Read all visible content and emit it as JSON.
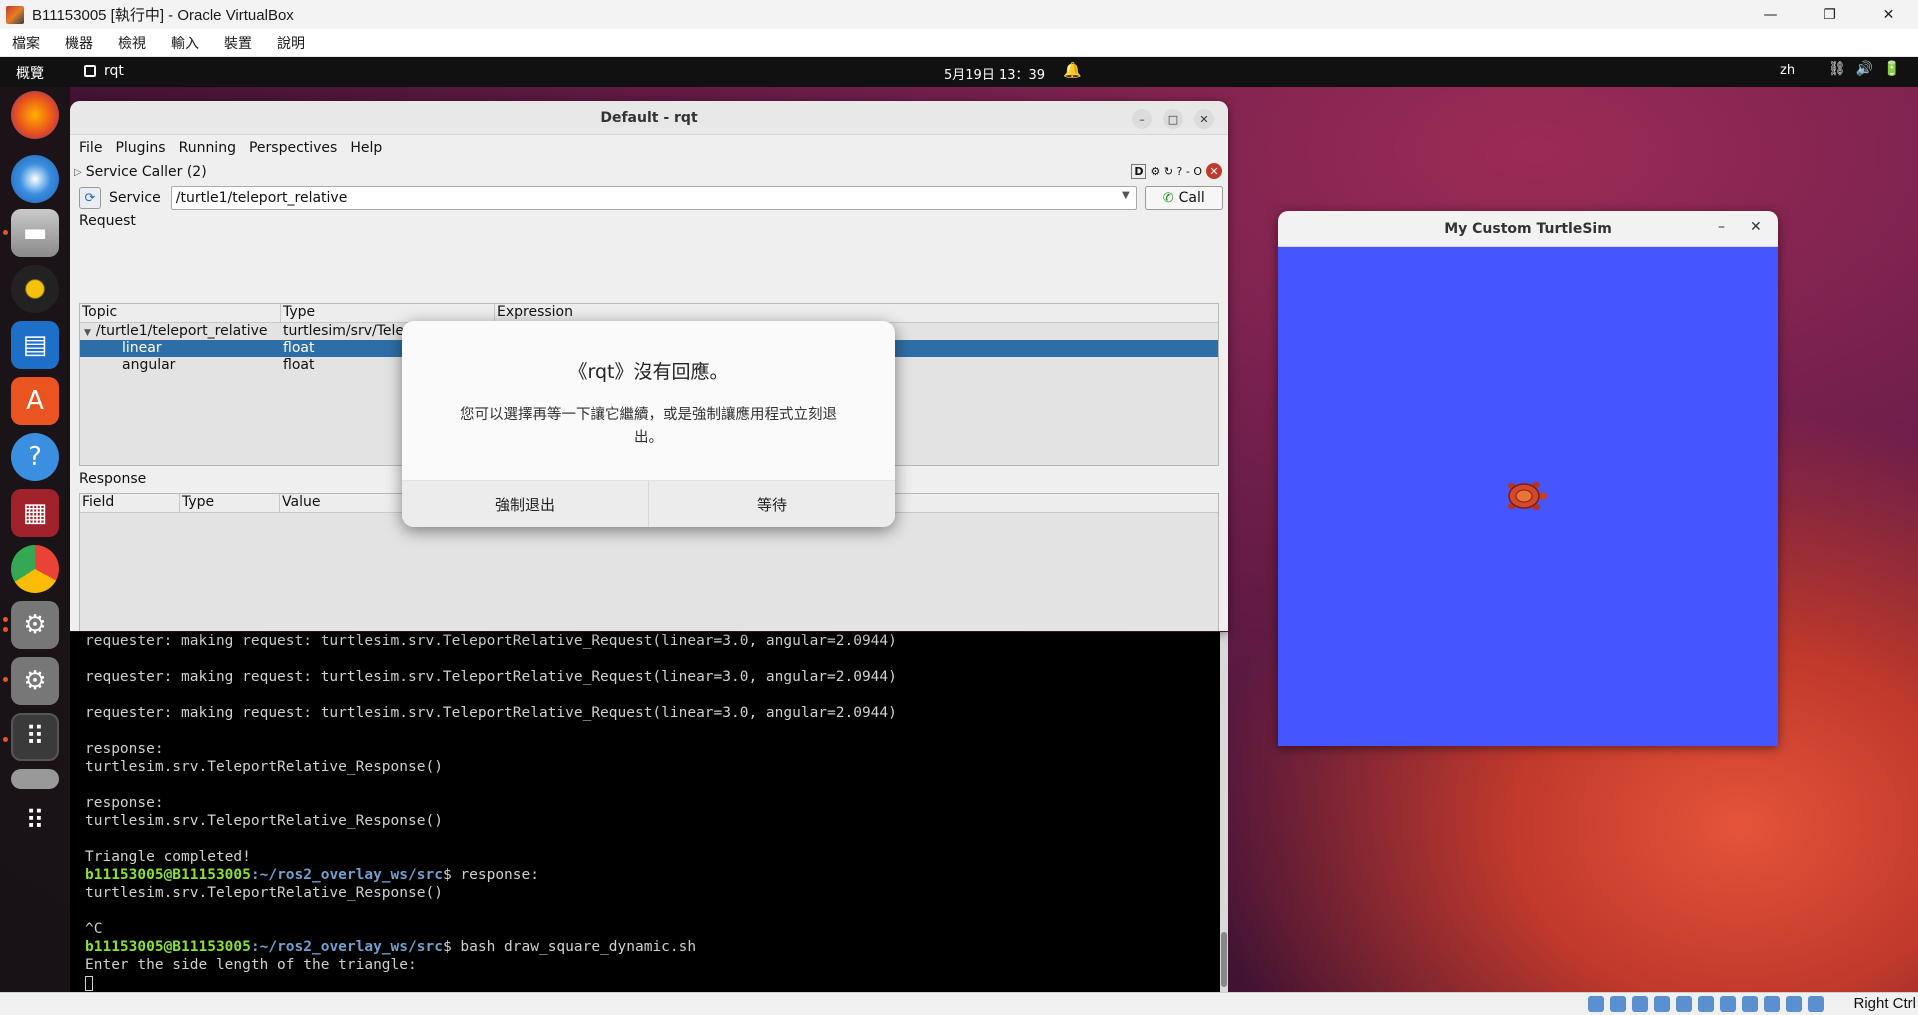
{
  "host": {
    "title": "B11153005 [執行中] - Oracle VirtualBox",
    "window_buttons": [
      "—",
      "❐",
      "✕"
    ],
    "menu": [
      "檔案",
      "機器",
      "檢視",
      "輸入",
      "裝置",
      "說明"
    ],
    "status_right": "Right Ctrl"
  },
  "topbar": {
    "activities": "概覽",
    "app_name": "rqt",
    "clock": "5月19日 13：39",
    "lang": "zh",
    "sys_icons": "⛓🔊🔋"
  },
  "dock": {
    "items": [
      "firefox-icon",
      "thunderbird-icon",
      "files-icon",
      "rhythmbox-icon",
      "writer-icon",
      "app-center-icon",
      "help-icon",
      "terminal-app-icon",
      "chrome-icon",
      "settings-icon",
      "settings-icon-2",
      "rqt-app-icon",
      "drive-icon",
      "show-apps-icon"
    ]
  },
  "rqt": {
    "title": "Default - rqt",
    "menu": [
      "File",
      "Plugins",
      "Running",
      "Perspectives",
      "Help"
    ],
    "plugin_title": "Service Caller (2)",
    "plugin_tools_d": "D",
    "plugin_tools_rest": "⚙ ↻ ? - O",
    "service_label": "Service",
    "service_value": "/turtle1/teleport_relative",
    "call_label": "Call",
    "request_label": "Request",
    "request_headers": [
      "Topic",
      "Type",
      "Expression"
    ],
    "request_rows": [
      {
        "topic": "/turtle1/teleport_relative",
        "type": "turtlesim/srv/Tele",
        "expr": ""
      },
      {
        "topic": "linear",
        "type": "float",
        "expr": ""
      },
      {
        "topic": "angular",
        "type": "float",
        "expr": ""
      }
    ],
    "response_label": "Response",
    "response_headers": [
      "Field",
      "Type",
      "Value"
    ]
  },
  "dialog": {
    "title": "《rqt》沒有回應。",
    "message": "您可以選擇再等一下讓它繼續，或是強制讓應用程式立刻退出。",
    "force_quit": "強制退出",
    "wait": "等待"
  },
  "terminal": {
    "lines": [
      "requester: making request: turtlesim.srv.TeleportRelative_Request(linear=3.0, angular=2.0944)",
      "",
      "requester: making request: turtlesim.srv.TeleportRelative_Request(linear=3.0, angular=2.0944)",
      "",
      "requester: making request: turtlesim.srv.TeleportRelative_Request(linear=3.0, angular=2.0944)",
      "",
      "response:",
      "turtlesim.srv.TeleportRelative_Response()",
      "",
      "response:",
      "turtlesim.srv.TeleportRelative_Response()",
      "",
      "Triangle completed!"
    ],
    "prompt_user": "b11153005@B11153005",
    "prompt_path": ":~/ros2_overlay_ws/src",
    "prompt_cmd_1": "$ response:",
    "line_after_1": "turtlesim.srv.TeleportRelative_Response()",
    "blank": "",
    "ctrl_c": "^C",
    "prompt_cmd_2": "$ bash draw_square_dynamic.sh",
    "input_prompt": "Enter the side length of the triangle:"
  },
  "turtlesim": {
    "title": "My Custom TurtleSim",
    "minimize": "–",
    "close": "✕",
    "background": "#4556ff"
  }
}
